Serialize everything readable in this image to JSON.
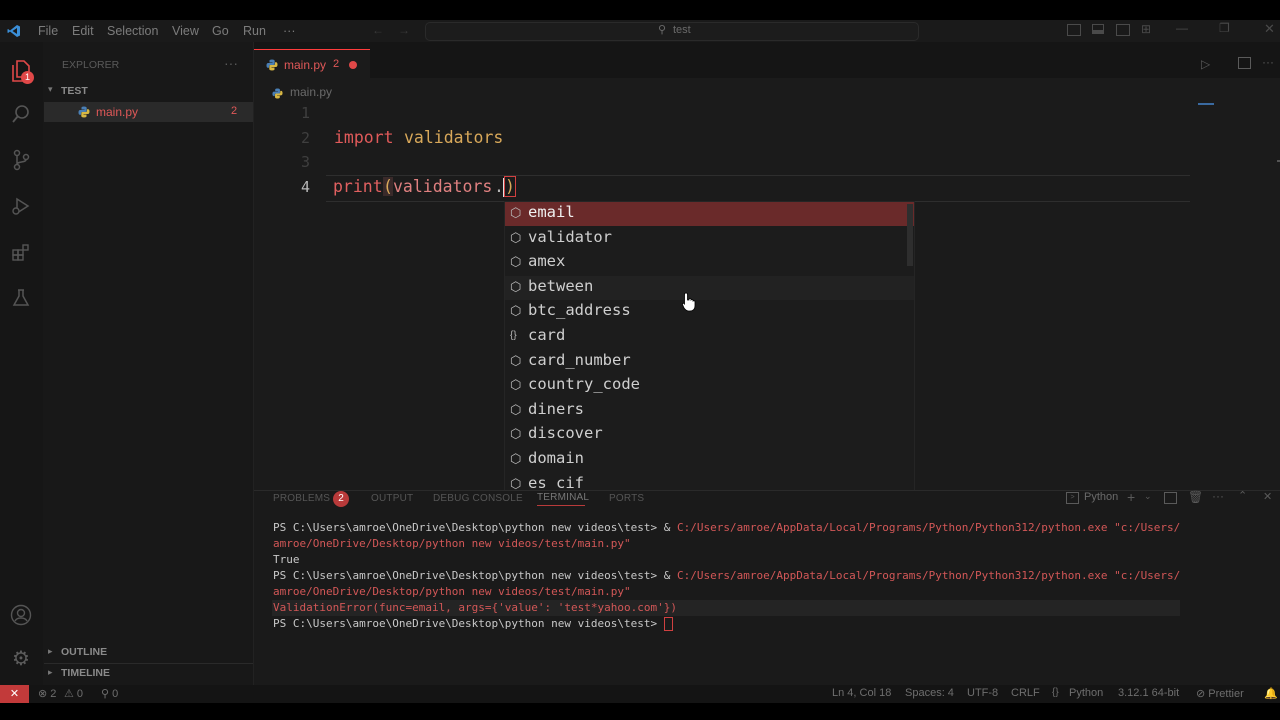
{
  "menu": [
    "File",
    "Edit",
    "Selection",
    "View",
    "Go",
    "Run",
    "···"
  ],
  "search": {
    "text": "test"
  },
  "explorer": {
    "title": "EXPLORER",
    "folder": "TEST",
    "file": "main.py",
    "file_badge": "2",
    "outline": "OUTLINE",
    "timeline": "TIMELINE"
  },
  "activity": {
    "explorer_badge": "1"
  },
  "tab": {
    "label": "main.py",
    "count": "2"
  },
  "breadcrumb": "main.py",
  "code": {
    "line_numbers": [
      "1",
      "2",
      "3",
      "4"
    ],
    "line2_kw": "import",
    "line2_mod": "validators",
    "line4_fn": "print",
    "line4_paren": "(",
    "line4_obj": "validators",
    "line4_dot": ".",
    "line4_close": ")"
  },
  "suggestions": [
    {
      "icon": "⬡",
      "label": "email"
    },
    {
      "icon": "⬡",
      "label": "validator"
    },
    {
      "icon": "⬡",
      "label": "amex"
    },
    {
      "icon": "⬡",
      "label": "between"
    },
    {
      "icon": "⬡",
      "label": "btc_address"
    },
    {
      "icon": "{}",
      "label": "card"
    },
    {
      "icon": "⬡",
      "label": "card_number"
    },
    {
      "icon": "⬡",
      "label": "country_code"
    },
    {
      "icon": "⬡",
      "label": "diners"
    },
    {
      "icon": "⬡",
      "label": "discover"
    },
    {
      "icon": "⬡",
      "label": "domain"
    },
    {
      "icon": "⬡",
      "label": "es_cif"
    }
  ],
  "panel": {
    "tabs": [
      "PROBLEMS",
      "OUTPUT",
      "DEBUG CONSOLE",
      "TERMINAL",
      "PORTS"
    ],
    "problems_count": "2",
    "shell": "Python"
  },
  "terminal": {
    "prompt1": "PS C:\\Users\\amroe\\OneDrive\\Desktop\\python new videos\\test> & ",
    "cmd1a": "C:/Users/amroe/AppData/Local/Programs/Python/Python312/python.exe \"c:/Users/",
    "cmd1b": "amroe/OneDrive/Desktop/python new videos/test/main.py\"",
    "out1": "True",
    "prompt2": "PS C:\\Users\\amroe\\OneDrive\\Desktop\\python new videos\\test> & ",
    "cmd2a": "C:/Users/amroe/AppData/Local/Programs/Python/Python312/python.exe \"c:/Users/",
    "cmd2b": "amroe/OneDrive/Desktop/python new videos/test/main.py\"",
    "out2": "ValidationError(func=email, args={'value': 'test*yahoo.com'})",
    "prompt3": "PS C:\\Users\\amroe\\OneDrive\\Desktop\\python new videos\\test> "
  },
  "status": {
    "errors": "⊗ 2",
    "warnings": "⚠ 0",
    "ports": "⚲ 0",
    "position": "Ln 4, Col 18",
    "spaces": "Spaces: 4",
    "encoding": "UTF-8",
    "eol": "CRLF",
    "language": "Python",
    "interpreter": "3.12.1 64-bit",
    "prettier": "⊘ Prettier"
  },
  "colors": {
    "accent": "#ff3c3c",
    "keyword": "#e05a5a",
    "function": "#e06060"
  }
}
